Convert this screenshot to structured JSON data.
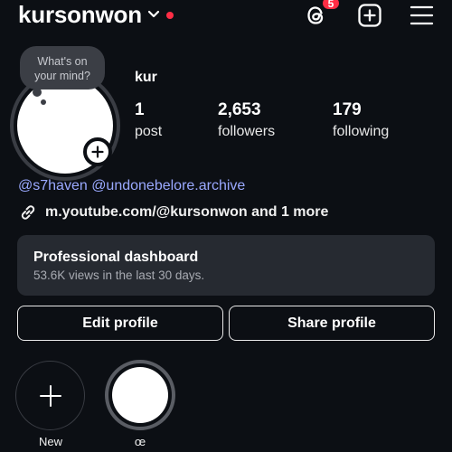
{
  "header": {
    "username": "kursonwon",
    "threads_badge": "5",
    "icons": [
      "chevron-down-icon",
      "threads-icon",
      "add-post-icon",
      "menu-icon"
    ],
    "accent_red": "#ff2d45"
  },
  "note": {
    "line1": "What's on",
    "line2": "your mind?"
  },
  "profile": {
    "display_name": "kur",
    "stats": {
      "posts_count": "1",
      "posts_label": "post",
      "followers_count": "2,653",
      "followers_label": "followers",
      "following_count": "179",
      "following_label": "following"
    },
    "mentions": [
      "@s7haven",
      "@undonebelore.archive"
    ],
    "link_text": "m.youtube.com/@kursonwon and 1 more",
    "mention_color": "#9aa9ff"
  },
  "dashboard": {
    "title": "Professional dashboard",
    "subtitle": "53.6K views in the last 30 days."
  },
  "buttons": {
    "edit": "Edit profile",
    "share": "Share profile"
  },
  "highlights": [
    {
      "label": "New"
    },
    {
      "label": "œ"
    }
  ]
}
